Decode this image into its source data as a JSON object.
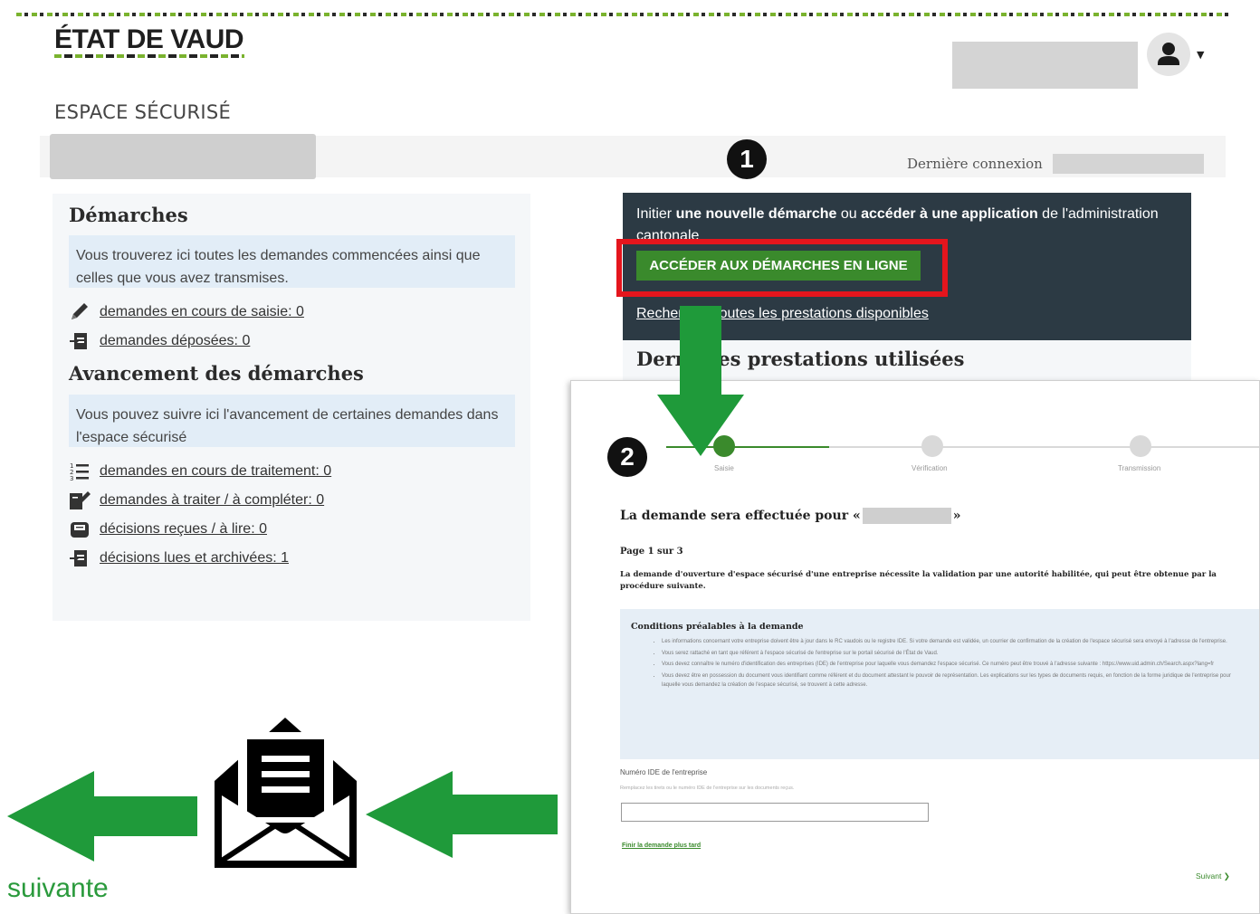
{
  "header": {
    "logo": "ÉTAT DE VAUD",
    "section_title": "ESPACE SÉCURISÉ",
    "last_connection_label": "Dernière connexion"
  },
  "demarches": {
    "title": "Démarches",
    "info": "Vous trouverez ici toutes les demandes commencées ainsi que celles que vous avez transmises.",
    "links": [
      {
        "icon": "pencil-icon",
        "label": "demandes en cours de saisie: 0"
      },
      {
        "icon": "document-icon",
        "label": "demandes déposées: 0"
      }
    ]
  },
  "avancement": {
    "title": "Avancement des démarches",
    "info": "Vous pouvez suivre ici l'avancement de certaines demandes dans l'espace sécurisé",
    "links": [
      {
        "icon": "list-icon",
        "label": "demandes en cours de traitement: 0"
      },
      {
        "icon": "sign-icon",
        "label": "demandes à traiter / à compléter: 0"
      },
      {
        "icon": "inbox-icon",
        "label": "décisions reçues / à lire: 0"
      },
      {
        "icon": "archive-icon",
        "label": "décisions lues et archivées: 1"
      }
    ]
  },
  "action_panel": {
    "text_1": "Initier ",
    "text_bold_1": "une nouvelle démarche",
    "text_2": " ou ",
    "text_bold_2": "accéder à une application",
    "text_3": " de l'administration cantonale",
    "button_label": "ACCÉDER AUX DÉMARCHES EN LIGNE",
    "search_link": "Rechercher toutes les prestations disponibles",
    "recent_title": "Dernières prestations utilisées"
  },
  "badges": {
    "one": "1",
    "two": "2"
  },
  "second_screen": {
    "steps": [
      {
        "label": "Saisie",
        "state": "current"
      },
      {
        "label": "Vérification",
        "state": "todo"
      },
      {
        "label": "Transmission",
        "state": "todo"
      }
    ],
    "title": "La demande sera effectuée pour «",
    "title_end": "»",
    "page": "Page 1 sur 3",
    "description": "La demande d'ouverture d'espace sécurisé d'une entreprise nécessite la validation par une autorité habilitée, qui peut être obtenue par la procédure suivante.",
    "conditions_title": "Conditions préalables à la demande",
    "conditions": [
      "Les informations concernant votre entreprise doivent être à jour dans le RC vaudois ou le registre IDE. Si votre demande est validée, un courrier de confirmation de la création de l'espace sécurisé sera envoyé à l'adresse de l'entreprise.",
      "Vous serez rattaché en tant que référent à l'espace sécurisé de l'entreprise sur le portail sécurisé de l'État de Vaud.",
      "Vous devez connaître le numéro d'identification des entreprises (IDE) de l'entreprise pour laquelle vous demandez l'espace sécurisé. Ce numéro peut être trouvé à l'adresse suivante : https://www.uid.admin.ch/Search.aspx?lang=fr",
      "Vous devez être en possession du document vous identifiant comme référent et du document attestant le pouvoir de représentation. Les explications sur les types de documents requis, en fonction de la forme juridique de l'entreprise pour laquelle vous demandez la création de l'espace sécurisé, se trouvent à cette adresse."
    ],
    "field_label": "Numéro IDE de l'entreprise",
    "field_hint": "Remplacez les tirets ou le numéro IDE de l'entreprise sur les documents reçus.",
    "later_link": "Finir la demande plus tard",
    "next_link": "Suivant ❯"
  },
  "caption": "suivante",
  "colors": {
    "green": "#3a8a2c",
    "arrow_green": "#1f9a3a",
    "red": "#e4151d",
    "dark": "#2c3a44"
  }
}
